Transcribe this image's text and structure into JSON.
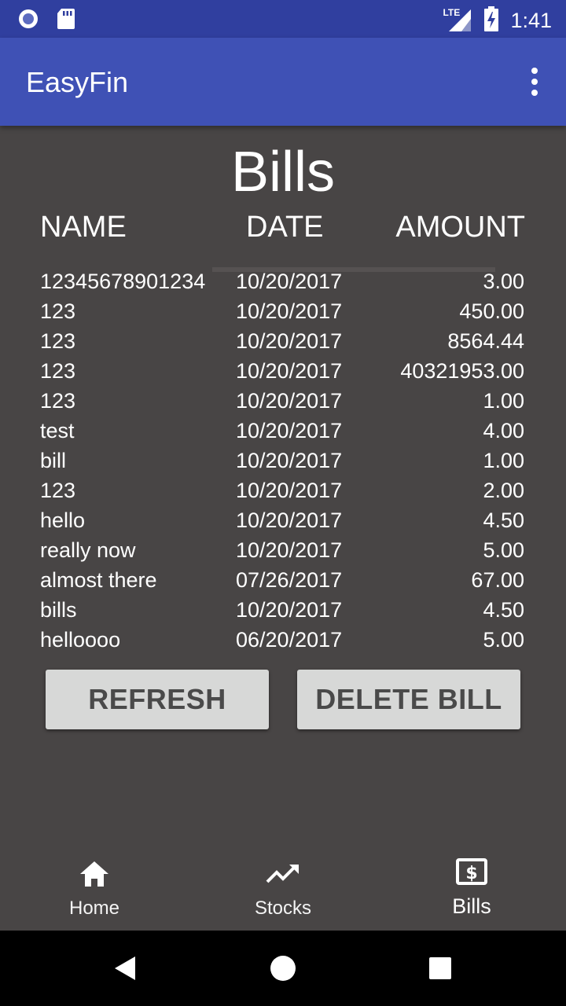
{
  "status_bar": {
    "time": "1:41",
    "network": "LTE",
    "icons": [
      "circle-notification-icon",
      "sd-card-icon",
      "signal-lte-icon",
      "battery-charging-icon"
    ]
  },
  "app_bar": {
    "title": "EasyFin",
    "menu_icon": "overflow-menu-icon"
  },
  "page": {
    "heading": "Bills",
    "columns": {
      "name": "NAME",
      "date": "DATE",
      "amount": "AMOUNT"
    }
  },
  "bills": [
    {
      "name": "12345678901234",
      "date": "10/20/2017",
      "amount": "3.00"
    },
    {
      "name": "123",
      "date": "10/20/2017",
      "amount": "450.00"
    },
    {
      "name": "123",
      "date": "10/20/2017",
      "amount": "8564.44"
    },
    {
      "name": "123",
      "date": "10/20/2017",
      "amount": "40321953.00"
    },
    {
      "name": "123",
      "date": "10/20/2017",
      "amount": "1.00"
    },
    {
      "name": "test",
      "date": "10/20/2017",
      "amount": "4.00"
    },
    {
      "name": "bill",
      "date": "10/20/2017",
      "amount": "1.00"
    },
    {
      "name": "123",
      "date": "10/20/2017",
      "amount": "2.00"
    },
    {
      "name": "hello",
      "date": "10/20/2017",
      "amount": "4.50"
    },
    {
      "name": "really now",
      "date": "10/20/2017",
      "amount": "5.00"
    },
    {
      "name": "almost there",
      "date": "07/26/2017",
      "amount": "67.00"
    },
    {
      "name": "bills",
      "date": "10/20/2017",
      "amount": "4.50"
    },
    {
      "name": "helloooo",
      "date": "06/20/2017",
      "amount": "5.00"
    }
  ],
  "buttons": {
    "refresh": "REFRESH",
    "delete": "DELETE BILL"
  },
  "bottom_nav": {
    "home": {
      "label": "Home",
      "icon": "home-icon"
    },
    "stocks": {
      "label": "Stocks",
      "icon": "trending-up-icon"
    },
    "bills": {
      "label": "Bills",
      "icon": "dollar-bill-icon",
      "selected": true
    }
  },
  "colors": {
    "status_bar": "#303f9f",
    "app_bar": "#3f51b5",
    "background": "#484545",
    "button": "#d7d8d7",
    "button_text": "#4a4a4a"
  }
}
